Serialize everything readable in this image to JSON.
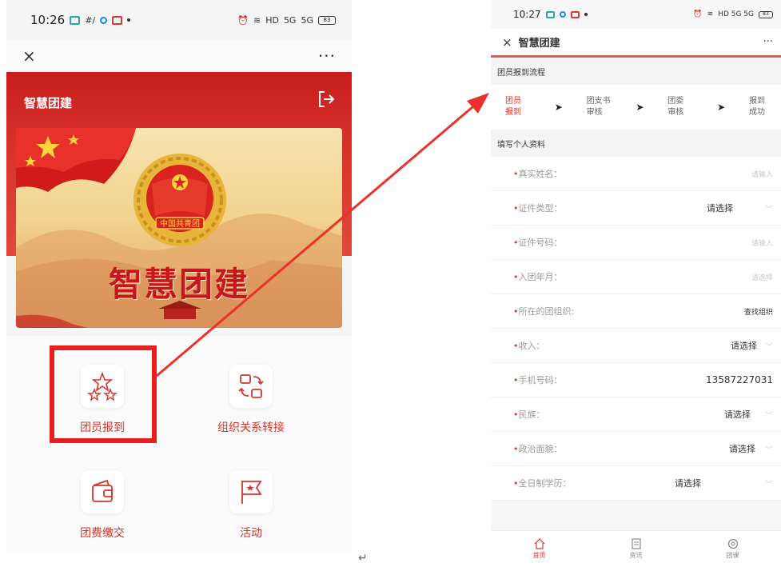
{
  "left": {
    "status": {
      "time": "10:26",
      "indicators": [
        "HD",
        "5G",
        "5G"
      ],
      "battery": "83"
    },
    "nav": {
      "close": "×",
      "more": "···"
    },
    "header": {
      "title": "智慧团建"
    },
    "banner": {
      "title": "智慧团建",
      "emblem_text": "中国共青团"
    },
    "grid": [
      {
        "label": "团员报到",
        "icon": "stars-icon",
        "highlighted": true
      },
      {
        "label": "组织关系转接",
        "icon": "transfer-icon",
        "highlighted": false
      },
      {
        "label": "团费缴交",
        "icon": "wallet-icon",
        "highlighted": false
      },
      {
        "label": "活动",
        "icon": "flag-icon",
        "highlighted": false
      }
    ],
    "highlight_color": "#e81f1f",
    "accent": "#d4352c"
  },
  "right": {
    "status": {
      "time": "10:27",
      "battery": "83"
    },
    "nav": {
      "close": "×",
      "title": "智慧团建",
      "more": "···"
    },
    "flow_title": "团员报到流程",
    "steps": [
      {
        "label_1": "团员",
        "label_2": "报到",
        "active": true
      },
      {
        "label_1": "团支书",
        "label_2": "审核",
        "active": false
      },
      {
        "label_1": "团委",
        "label_2": "审核",
        "active": false
      },
      {
        "label_1": "报到",
        "label_2": "成功",
        "active": false
      }
    ],
    "step_arrow": "➤",
    "form_title": "填写个人资料",
    "fields": [
      {
        "label": "真实姓名：",
        "required": true,
        "value": "",
        "placeholder": "请输入",
        "dropdown": false
      },
      {
        "label": "证件类型：",
        "required": true,
        "value": "请选择",
        "placeholder": "",
        "dropdown": true
      },
      {
        "label": "证件号码：",
        "required": true,
        "value": "",
        "placeholder": "请输入",
        "dropdown": false
      },
      {
        "label": "入团年月：",
        "required": true,
        "value": "",
        "placeholder": "请选择",
        "dropdown": false
      },
      {
        "label": "所在的团组织:",
        "required": true,
        "value": "查找组织",
        "placeholder": "",
        "dropdown": false
      },
      {
        "label": "收入：",
        "required": true,
        "value": "请选择",
        "placeholder": "",
        "dropdown": true
      },
      {
        "label": "手机号码：",
        "required": true,
        "value": "13587227031",
        "placeholder": "",
        "dropdown": false
      },
      {
        "label": "民族：",
        "required": true,
        "value": "请选择",
        "placeholder": "",
        "dropdown": true
      },
      {
        "label": "政治面貌：",
        "required": true,
        "value": "请选择",
        "placeholder": "",
        "dropdown": true
      },
      {
        "label": "全日制学历：",
        "required": true,
        "value": "请选择",
        "placeholder": "",
        "dropdown": true
      }
    ],
    "tabs": [
      {
        "label": "首页",
        "icon": "home-icon",
        "active": true
      },
      {
        "label": "资讯",
        "icon": "news-icon",
        "active": false
      },
      {
        "label": "团课",
        "icon": "class-icon",
        "active": false
      }
    ]
  },
  "return_mark": "↵",
  "arrow_color": "#e8322b"
}
